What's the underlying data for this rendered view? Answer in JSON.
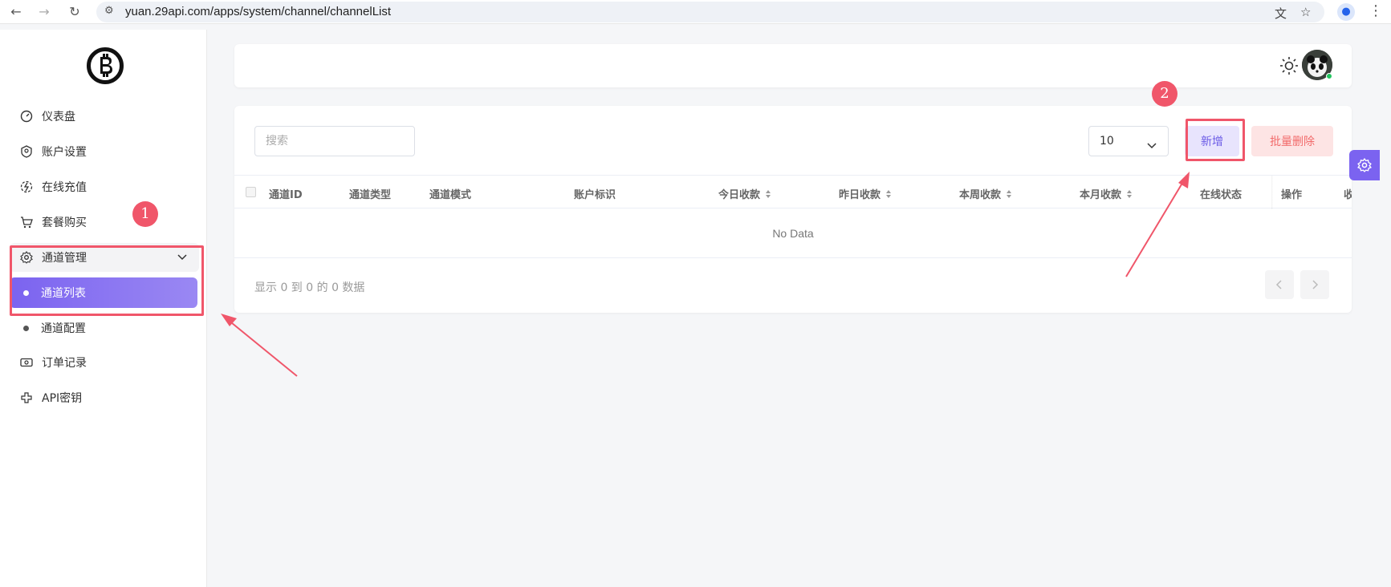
{
  "browser": {
    "url": "yuan.29api.com/apps/system/channel/channelList"
  },
  "sidebar": {
    "items": [
      {
        "label": "仪表盘"
      },
      {
        "label": "账户设置"
      },
      {
        "label": "在线充值"
      },
      {
        "label": "套餐购买"
      },
      {
        "label": "通道管理"
      },
      {
        "label": "通道列表"
      },
      {
        "label": "通道配置"
      },
      {
        "label": "订单记录"
      },
      {
        "label": "API密钥"
      }
    ]
  },
  "toolbar": {
    "search_placeholder": "搜索",
    "page_size": "10",
    "add_label": "新增",
    "batch_delete_label": "批量删除"
  },
  "table": {
    "columns": [
      "通道ID",
      "通道类型",
      "通道模式",
      "账户标识",
      "今日收款",
      "昨日收款",
      "本周收款",
      "本月收款",
      "在线状态",
      "操作",
      "收"
    ],
    "empty_text": "No Data"
  },
  "pagination": {
    "summary": "显示 0 到 0 的 0 数据"
  },
  "annotations": {
    "badge1": "1",
    "badge2": "2"
  },
  "colors": {
    "accent": "#7b63f0",
    "annotation": "#f0566a",
    "danger": "#f26b6b"
  }
}
